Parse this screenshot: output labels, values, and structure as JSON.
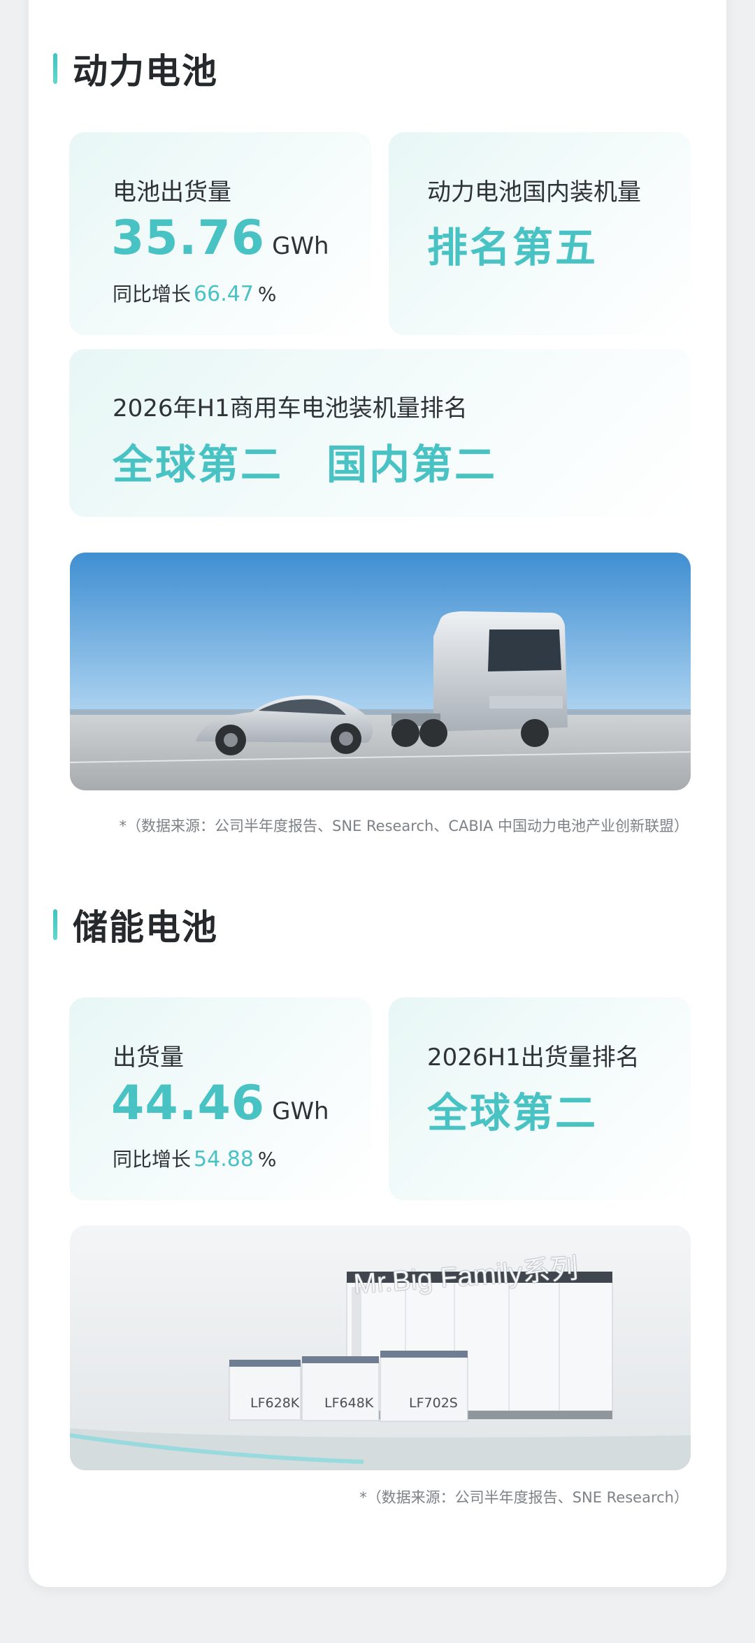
{
  "power": {
    "title": "动力电池",
    "shipment": {
      "label": "电池出货量",
      "value": "35.76",
      "unit": "GWh",
      "growth_prefix": "同比增长",
      "growth_value": "66.47",
      "growth_unit": "%"
    },
    "domestic": {
      "label": "动力电池国内装机量",
      "rank": "排名第五"
    },
    "commercial": {
      "label": "2026年H1商用车电池装机量排名",
      "global_rank": "全球第二",
      "domestic_rank": "国内第二"
    },
    "source": "*（数据来源：公司半年度报告、SNE Research、CABIA 中国动力电池产业创新联盟）"
  },
  "storage": {
    "title": "储能电池",
    "shipment": {
      "label": "出货量",
      "value": "44.46",
      "unit": "GWh",
      "growth_prefix": "同比增长",
      "growth_value": "54.88",
      "growth_unit": "%"
    },
    "ranking": {
      "label": "2026H1出货量排名",
      "rank": "全球第二"
    },
    "product": {
      "series": "Mr.Big Family系列",
      "models": [
        "LF628K",
        "LF648K",
        "LF702S"
      ]
    },
    "source": "*（数据来源：公司半年度报告、SNE Research）"
  },
  "colors": {
    "accent": "#49c2c3",
    "text": "#2b2f33",
    "background": "#eef0f2"
  }
}
